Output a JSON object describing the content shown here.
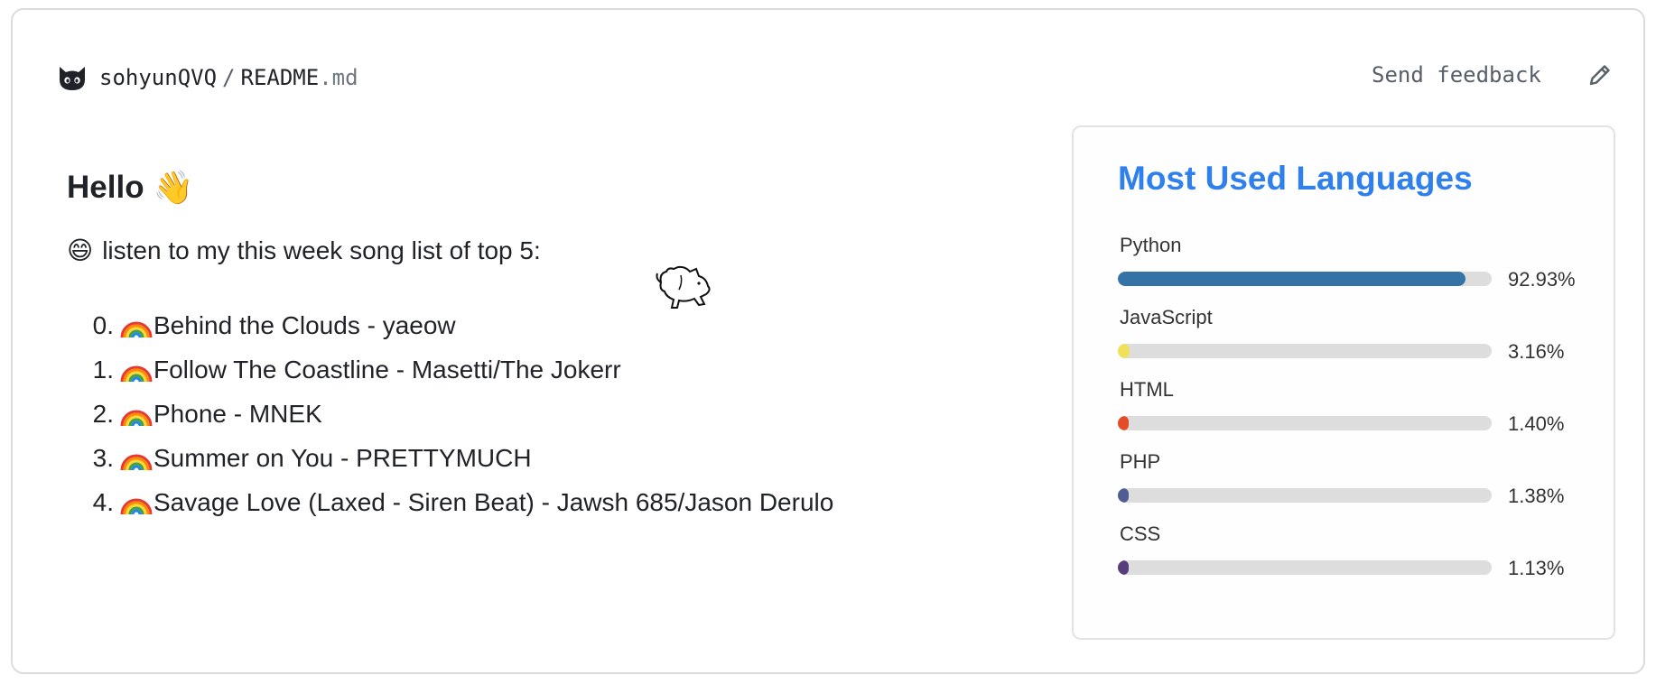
{
  "header": {
    "owner": "sohyunQVQ",
    "separator": "/",
    "file_name": "README",
    "file_ext": ".md",
    "feedback_label": "Send feedback",
    "logo_icon": "cat-logo-icon",
    "edit_icon": "pencil-icon"
  },
  "readme": {
    "heading": "Hello",
    "heading_emoji": "👋",
    "intro_emoji": "😄",
    "intro": "listen to my this week song list of top 5:",
    "songs": [
      {
        "num": "0.",
        "title": "Behind the Clouds - yaeow"
      },
      {
        "num": "1.",
        "title": "Follow The Coastline - Masetti/The Jokerr"
      },
      {
        "num": "2.",
        "title": "Phone - MNEK"
      },
      {
        "num": "3.",
        "title": "Summer on You - PRETTYMUCH"
      },
      {
        "num": "4.",
        "title": "Savage Love (Laxed - Siren Beat) - Jawsh 685/Jason Derulo"
      }
    ]
  },
  "languages": {
    "title": "Most Used Languages",
    "items": [
      {
        "name": "Python",
        "percent": "92.93%",
        "value": 92.93,
        "color": "#3572A5"
      },
      {
        "name": "JavaScript",
        "percent": "3.16%",
        "value": 3.16,
        "color": "#f1e05a"
      },
      {
        "name": "HTML",
        "percent": "1.40%",
        "value": 1.4,
        "color": "#e34c26"
      },
      {
        "name": "PHP",
        "percent": "1.38%",
        "value": 1.38,
        "color": "#4F5D95"
      },
      {
        "name": "CSS",
        "percent": "1.13%",
        "value": 1.13,
        "color": "#563d7c"
      }
    ]
  }
}
